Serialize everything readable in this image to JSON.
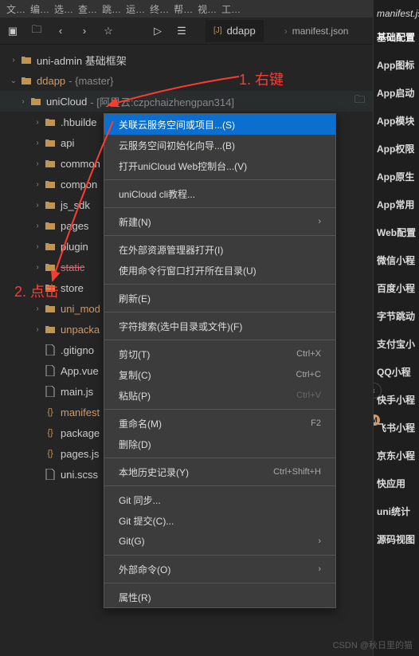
{
  "top_menu": [
    "文…",
    "编…",
    "选…",
    "查…",
    "跳…",
    "运…",
    "终…",
    "帮…",
    "视…",
    "工…"
  ],
  "breadcrumb": {
    "tab_icon": "[J]",
    "tab": "ddapp",
    "sep": "›",
    "file": "manifest.json"
  },
  "tree": {
    "root1": {
      "name": "uni-admin 基础框架"
    },
    "root2": {
      "name": "ddapp",
      "branch": "{master}"
    },
    "unicloud": {
      "name": "uniCloud",
      "suffix": "- [阿里云:czpchaizhengpan314]"
    },
    "items": [
      {
        "name": ".hbuilde",
        "type": "folder"
      },
      {
        "name": "api",
        "type": "folder"
      },
      {
        "name": "common",
        "type": "folder"
      },
      {
        "name": "compon",
        "type": "folder"
      },
      {
        "name": "js_sdk",
        "type": "folder"
      },
      {
        "name": "pages",
        "type": "folder"
      },
      {
        "name": "plugin",
        "type": "folder"
      },
      {
        "name": "static",
        "type": "folder",
        "hl": true
      },
      {
        "name": "store",
        "type": "folder"
      },
      {
        "name": "uni_mod",
        "type": "folder",
        "orange": true
      },
      {
        "name": "unpacka",
        "type": "folder",
        "orange": true
      },
      {
        "name": ".gitigno",
        "type": "file"
      },
      {
        "name": "App.vue",
        "type": "file"
      },
      {
        "name": "main.js",
        "type": "file"
      },
      {
        "name": "manifest",
        "type": "file",
        "orange": true
      },
      {
        "name": "package",
        "type": "file"
      },
      {
        "name": "pages.js",
        "type": "file"
      },
      {
        "name": "uni.scss",
        "type": "file"
      }
    ]
  },
  "context_menu": [
    {
      "label": "关联云服务空间或项目...(S)",
      "highlighted": true
    },
    {
      "label": "云服务空间初始化向导...(B)"
    },
    {
      "label": "打开uniCloud Web控制台...(V)"
    },
    {
      "sep": true
    },
    {
      "label": "uniCloud cli教程..."
    },
    {
      "sep": true
    },
    {
      "label": "新建(N)",
      "sub": "›"
    },
    {
      "sep": true
    },
    {
      "label": "在外部资源管理器打开(I)"
    },
    {
      "label": "使用命令行窗口打开所在目录(U)"
    },
    {
      "sep": true
    },
    {
      "label": "刷新(E)"
    },
    {
      "sep": true
    },
    {
      "label": "字符搜索(选中目录或文件)(F)"
    },
    {
      "sep": true
    },
    {
      "label": "剪切(T)",
      "shortcut": "Ctrl+X"
    },
    {
      "label": "复制(C)",
      "shortcut": "Ctrl+C"
    },
    {
      "label": "粘贴(P)",
      "shortcut": "Ctrl+V",
      "disabled": true
    },
    {
      "sep": true
    },
    {
      "label": "重命名(M)",
      "shortcut": "F2"
    },
    {
      "label": "删除(D)"
    },
    {
      "sep": true
    },
    {
      "label": "本地历史记录(Y)",
      "shortcut": "Ctrl+Shift+H"
    },
    {
      "sep": true
    },
    {
      "label": "Git 同步..."
    },
    {
      "label": "Git 提交(C)..."
    },
    {
      "label": "Git(G)",
      "sub": "›"
    },
    {
      "sep": true
    },
    {
      "label": "外部命令(O)",
      "sub": "›"
    },
    {
      "sep": true
    },
    {
      "label": "属性(R)"
    }
  ],
  "outline": {
    "title": "manifest.js",
    "items": [
      "基础配置",
      "App图标",
      "App启动",
      "App模块",
      "App权限",
      "App原生",
      "App常用",
      "Web配置",
      "微信小程",
      "百度小程",
      "字节跳动",
      "支付宝小",
      "QQ小程",
      "快手小程",
      "飞书小程",
      "京东小程",
      "快应用",
      "uni统计",
      "源码视图"
    ]
  },
  "annotations": {
    "a1": "1. 右键",
    "a2": "2. 点击"
  },
  "watermark": "CSDN @秋日里的猫",
  "watermark2": ""
}
